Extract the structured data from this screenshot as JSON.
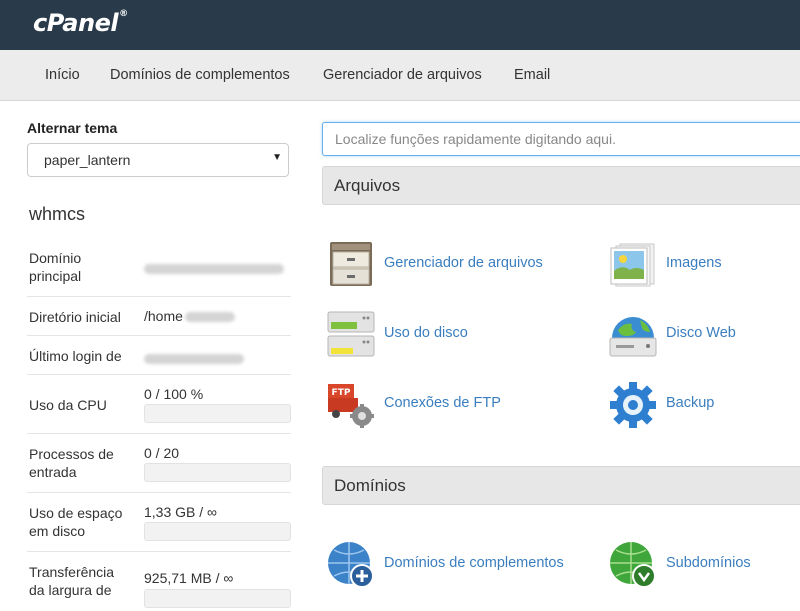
{
  "topbar": {
    "logo": "cPanel",
    "logo_mark": "®"
  },
  "nav": {
    "items": [
      "Início",
      "Domínios de complementos",
      "Gerenciador de arquivos",
      "Email"
    ]
  },
  "sidebar": {
    "theme_label": "Alternar tema",
    "theme_value": "paper_lantern",
    "username": "whmcs",
    "stats": [
      {
        "label": "Domínio principal",
        "value": ""
      },
      {
        "label": "Diretório inicial",
        "value": "/home"
      },
      {
        "label": "Último login de",
        "value": ""
      },
      {
        "label": "Uso da CPU",
        "value": "0 / 100 %",
        "progress": 0
      },
      {
        "label": "Processos de entrada",
        "value": "0 / 20",
        "progress": 0
      },
      {
        "label": "Uso de espaço em disco",
        "value": "1,33 GB / ∞",
        "progress": 0
      },
      {
        "label": "Transferência da largura de",
        "value": "925,71 MB / ∞",
        "progress": 0
      }
    ]
  },
  "search": {
    "placeholder": "Localize funções rapidamente digitando aqui."
  },
  "sections": {
    "files": {
      "title": "Arquivos",
      "tools": [
        {
          "label": "Gerenciador de arquivos",
          "icon": "file-cabinet-icon"
        },
        {
          "label": "Imagens",
          "icon": "images-icon"
        },
        {
          "label": "Uso do disco",
          "icon": "disk-usage-icon"
        },
        {
          "label": "Disco Web",
          "icon": "web-disk-icon"
        },
        {
          "label": "Conexões de FTP",
          "icon": "ftp-connections-icon"
        },
        {
          "label": "Backup",
          "icon": "backup-icon"
        }
      ]
    },
    "domains": {
      "title": "Domínios",
      "tools": [
        {
          "label": "Domínios de complementos",
          "icon": "addon-domains-icon"
        },
        {
          "label": "Subdomínios",
          "icon": "subdomains-icon"
        }
      ]
    }
  },
  "colors": {
    "topbar": "#293a4a",
    "navbar": "#ececec",
    "link": "#3a7ebf",
    "section_header": "#e7e7e7"
  }
}
